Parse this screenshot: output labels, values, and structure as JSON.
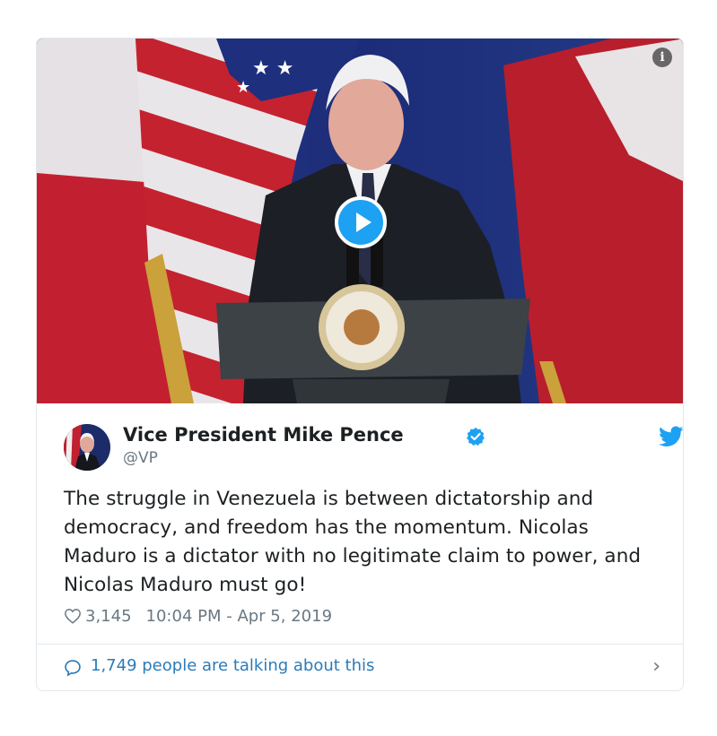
{
  "tweet": {
    "author_name": "Vice President Mike Pence",
    "handle": "@VP",
    "text": "The struggle in Venezuela is between dictatorship and democracy, and freedom has the momentum. Nicolas Maduro is a dictator with no legitimate claim to power, and Nicolas Maduro must go!",
    "likes": "3,145",
    "timestamp": "10:04 PM - Apr 5, 2019",
    "conversation": "1,749 people are talking about this"
  },
  "icons": {
    "play": "play-icon",
    "info": "info-icon",
    "verified": "verified-badge-icon",
    "bird": "twitter-bird-icon",
    "heart": "heart-icon",
    "reply": "reply-bubble-icon",
    "chevron": "chevron-right-icon"
  },
  "colors": {
    "accent": "#1da1f2",
    "link": "#2b7bb9",
    "muted": "#697882",
    "border": "#e1e8ed"
  }
}
